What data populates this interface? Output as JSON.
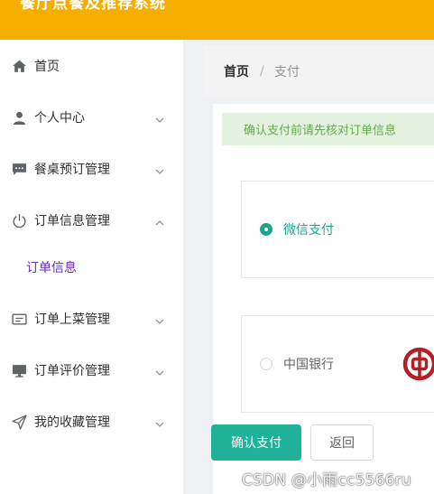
{
  "app": {
    "title": "餐厅点餐及推荐系统"
  },
  "sidebar": {
    "items": [
      {
        "label": "首页",
        "icon": "home-icon"
      },
      {
        "label": "个人中心",
        "icon": "user-icon"
      },
      {
        "label": "餐桌预订管理",
        "icon": "chat-icon"
      },
      {
        "label": "订单信息管理",
        "icon": "power-icon",
        "expanded": true
      },
      {
        "label": "订单上菜管理",
        "icon": "card-icon"
      },
      {
        "label": "订单评价管理",
        "icon": "monitor-icon"
      },
      {
        "label": "我的收藏管理",
        "icon": "send-icon"
      }
    ],
    "sub_items": [
      {
        "label": "订单信息",
        "parent": "订单信息管理"
      }
    ]
  },
  "breadcrumb": {
    "home": "首页",
    "separator": "/",
    "current": "支付"
  },
  "alert": {
    "text": "确认支付前请先核对订单信息",
    "color": "#67a64e"
  },
  "payment_options": [
    {
      "label": "微信支付",
      "selected": true
    },
    {
      "label": "中国银行",
      "selected": false,
      "logo": "bank-of-china-icon"
    }
  ],
  "buttons": {
    "confirm": "确认支付",
    "back": "返回"
  },
  "watermark": "CSDN @小雨cc5566ru",
  "colors": {
    "topbar": "#f5ad00",
    "accent": "#20b299",
    "submenu_active": "#6a2bbf"
  }
}
